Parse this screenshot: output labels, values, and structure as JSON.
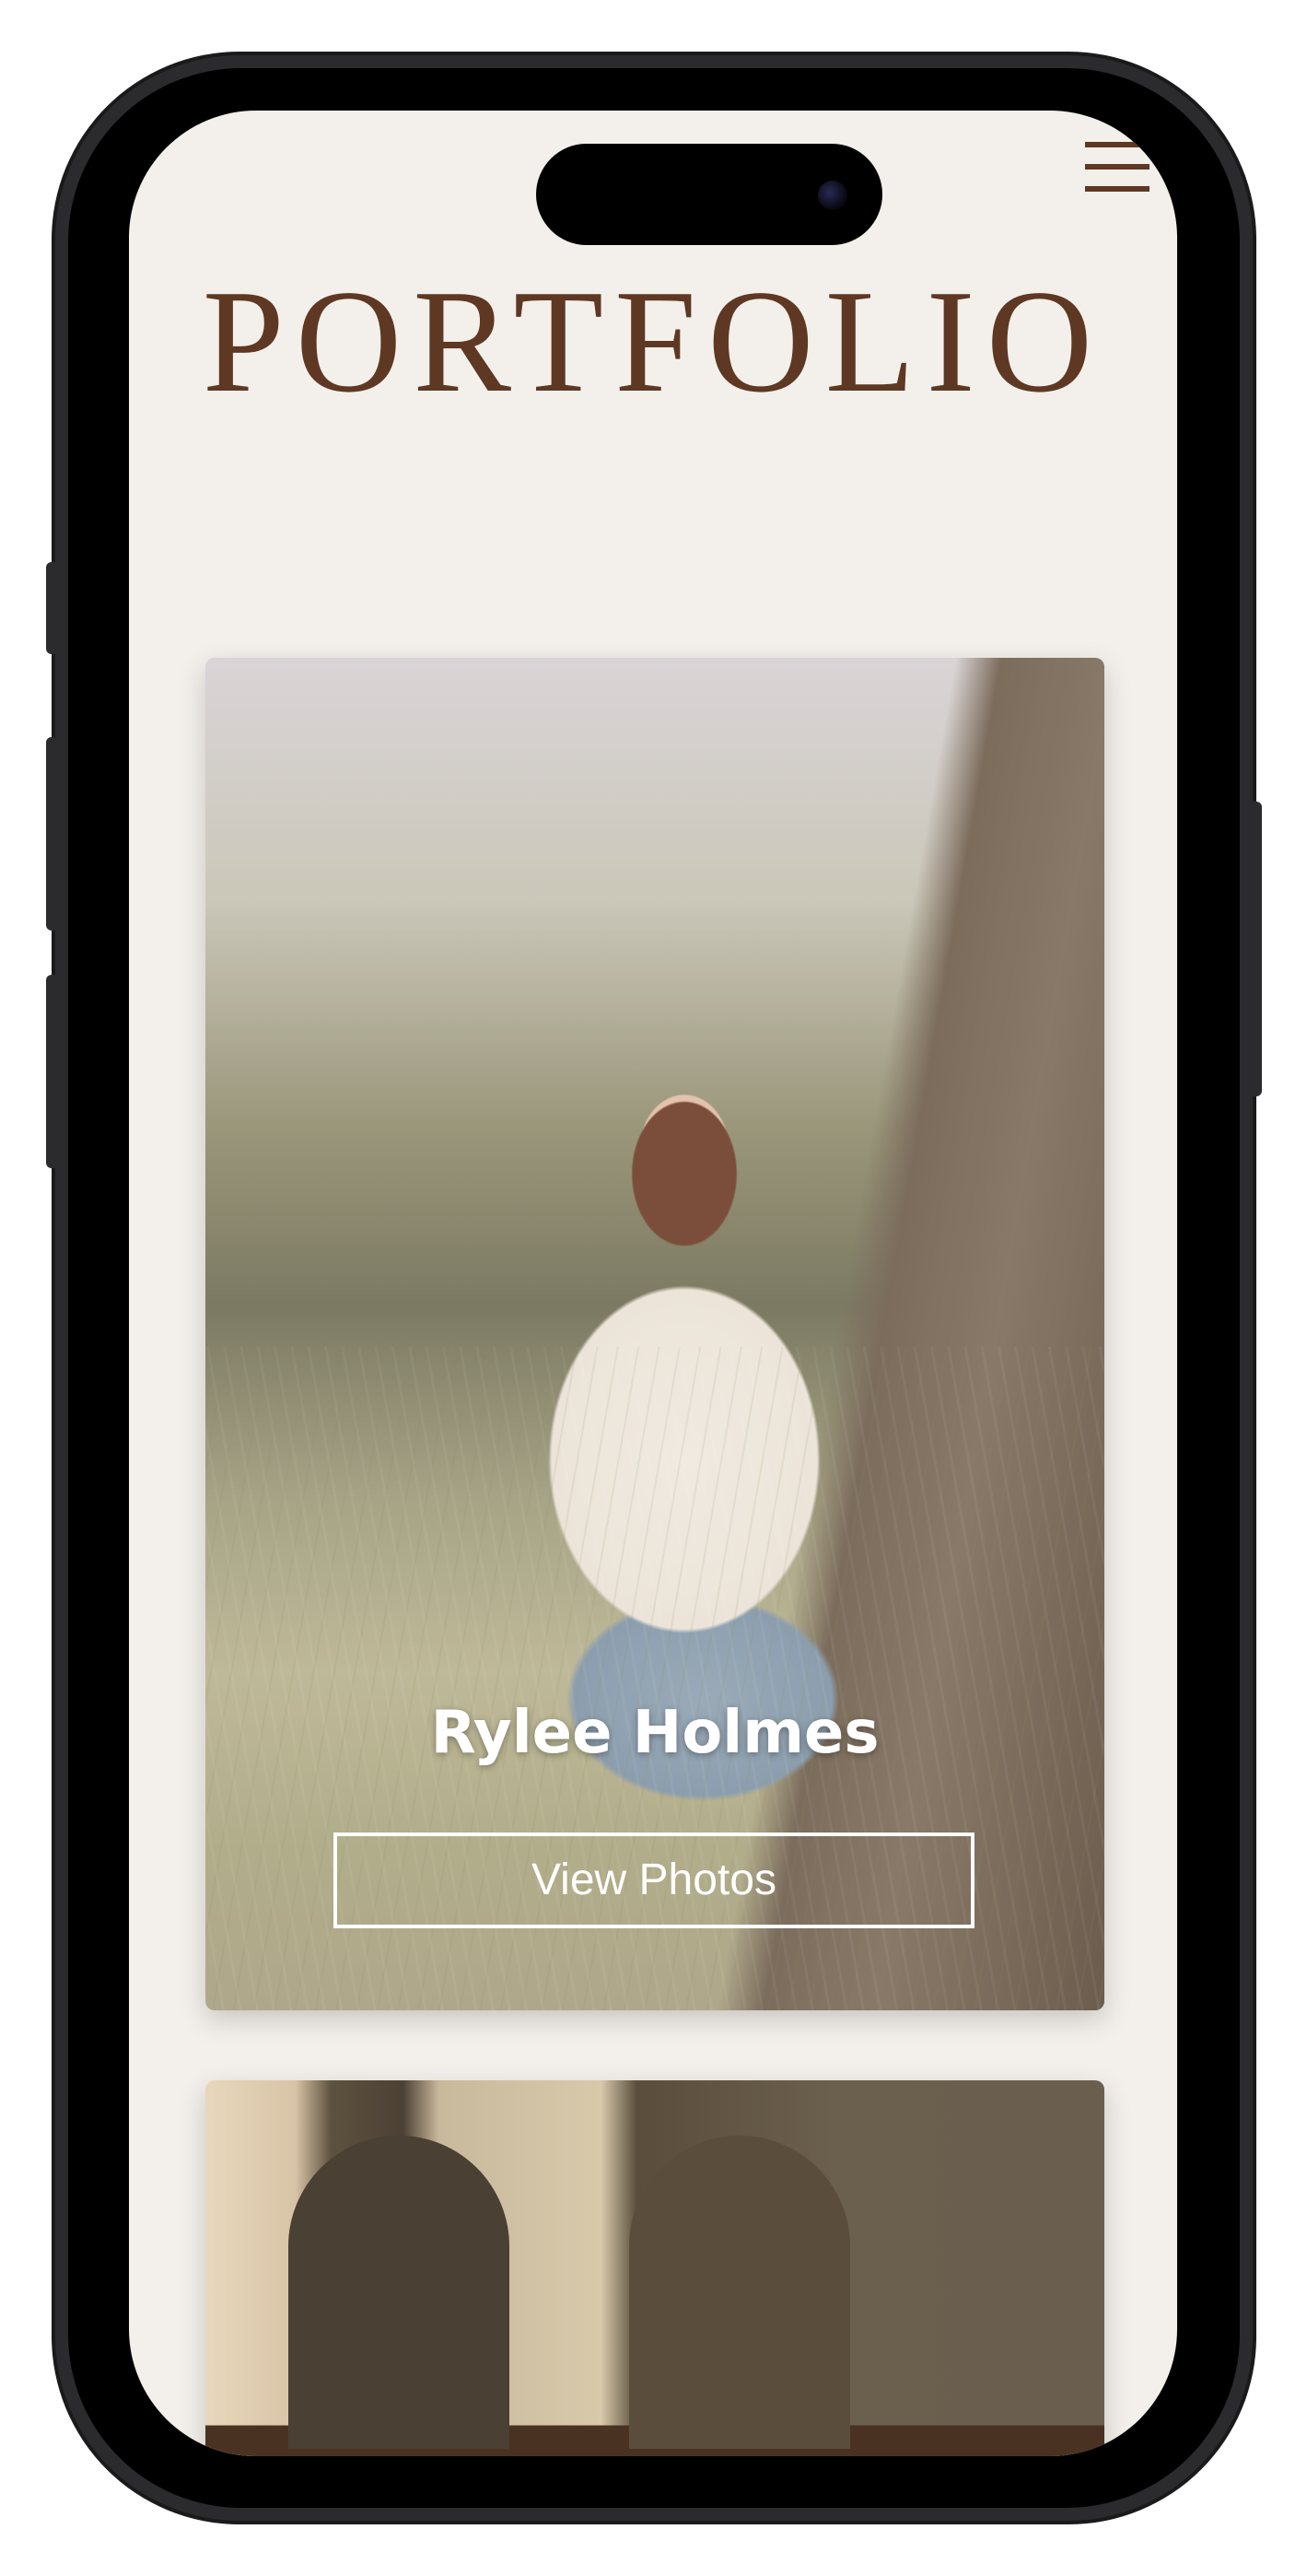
{
  "header": {
    "title": "PORTFOLIO",
    "menu_icon": "hamburger-menu-icon"
  },
  "colors": {
    "brand": "#5e3823",
    "background": "#f3f0eb",
    "button_border": "#ffffff"
  },
  "cards": [
    {
      "name": "Rylee Holmes",
      "button_label": "View Photos"
    },
    {
      "name": "",
      "button_label": ""
    }
  ]
}
